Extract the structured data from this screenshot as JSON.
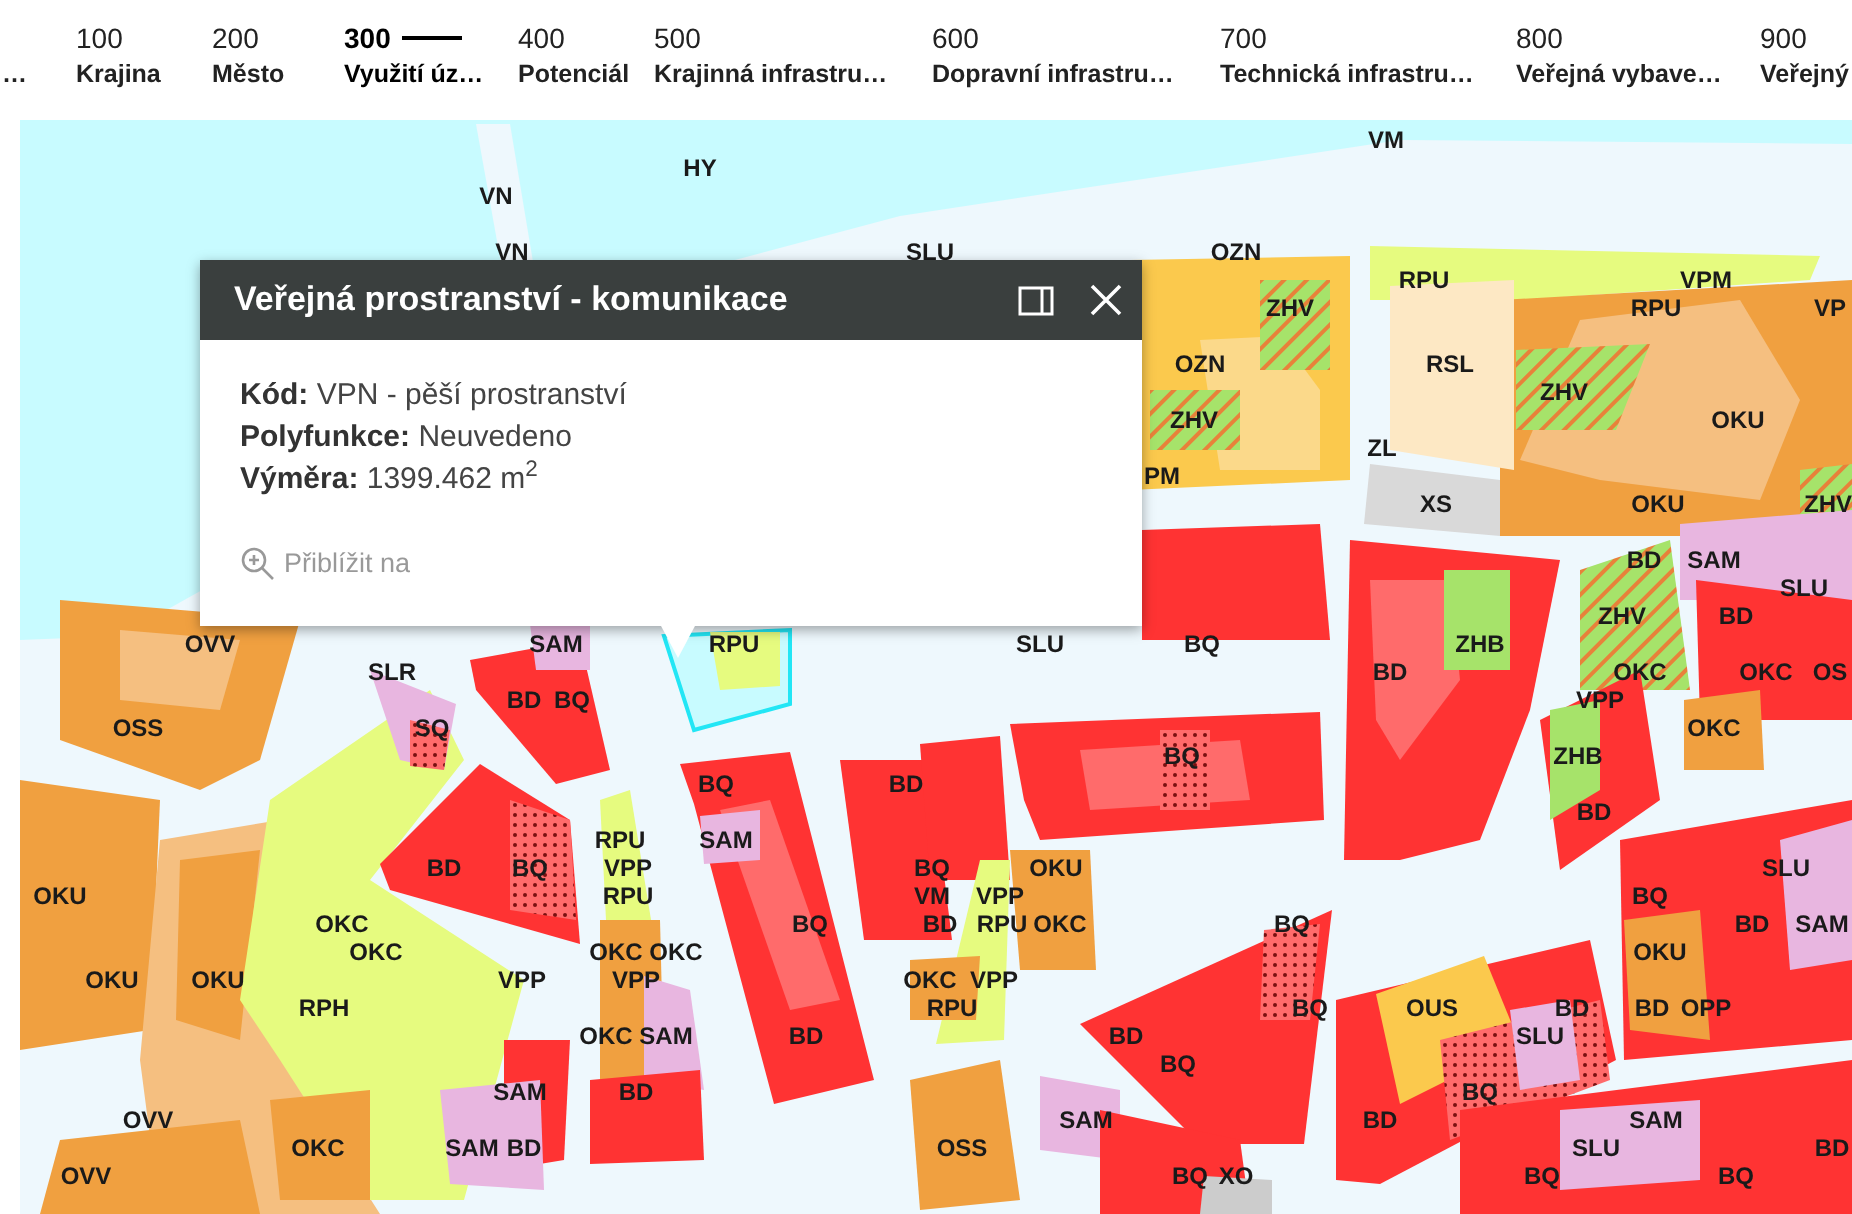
{
  "tabs": [
    {
      "label": "…",
      "selected": false
    },
    {
      "number": "100",
      "label": "Krajina",
      "selected": false
    },
    {
      "number": "200",
      "label": "Město",
      "selected": false
    },
    {
      "number": "300",
      "label": "Využití úz…",
      "selected": true
    },
    {
      "number": "400",
      "label": "Potenciál",
      "selected": false
    },
    {
      "number": "500",
      "label": "Krajinná infrastru…",
      "selected": false
    },
    {
      "number": "600",
      "label": "Dopravní infrastru…",
      "selected": false
    },
    {
      "number": "700",
      "label": "Technická infrastru…",
      "selected": false
    },
    {
      "number": "800",
      "label": "Veřejná vybave…",
      "selected": false
    },
    {
      "number": "900",
      "label": "Veřejný",
      "selected": false
    }
  ],
  "map": {
    "labels": [
      "VM",
      "HY",
      "VN",
      "VN",
      "SLU",
      "OZN",
      "RPU",
      "VPM",
      "ZHV",
      "RPU",
      "VP",
      "OZN",
      "RSL",
      "ZHV",
      "ZHV",
      "OKU",
      "ZL",
      "PM",
      "XS",
      "OKU",
      "ZHV",
      "BD",
      "SAM",
      "SLU",
      "ZHV",
      "BD",
      "OVV",
      "SAM",
      "RPU",
      "SLU",
      "BQ",
      "ZHB",
      "SLR",
      "BD",
      "OKC",
      "OKC",
      "OS",
      "BD",
      "BQ",
      "VPP",
      "OSS",
      "SQ",
      "OKC",
      "BQ",
      "ZHB",
      "BQ",
      "BD",
      "BD",
      "RPU",
      "SAM",
      "BD",
      "BQ",
      "VPP",
      "BQ",
      "OKU",
      "SLU",
      "OKU",
      "RPU",
      "VM",
      "VPP",
      "BQ",
      "OKC",
      "BQ",
      "BD",
      "RPU",
      "OKC",
      "BQ",
      "BD",
      "SAM",
      "OKC",
      "OKC",
      "OKC",
      "OKU",
      "OKU",
      "OKU",
      "VPP",
      "VPP",
      "OKC",
      "VPP",
      "RPH",
      "RPU",
      "BQ",
      "OUS",
      "BD",
      "BD",
      "OPP",
      "OKC",
      "SAM",
      "BD",
      "BD",
      "SLU",
      "BQ",
      "SAM",
      "BD",
      "BQ",
      "OVV",
      "SAM",
      "BD",
      "SAM",
      "OKC",
      "SAM",
      "BD",
      "OSS",
      "SLU",
      "BD",
      "OVV",
      "BQ",
      "XO",
      "BQ",
      "BQ"
    ]
  },
  "popup": {
    "title": "Veřejná prostranství - komunikace",
    "fields": [
      {
        "label": "Kód:",
        "value": "VPN - pěší prostranství"
      },
      {
        "label": "Polyfunkce:",
        "value": "Neuvedeno"
      },
      {
        "label": "Výměra:",
        "value": "1399.462 m$^{2}$"
      }
    ],
    "action": "Přiblížit na"
  }
}
